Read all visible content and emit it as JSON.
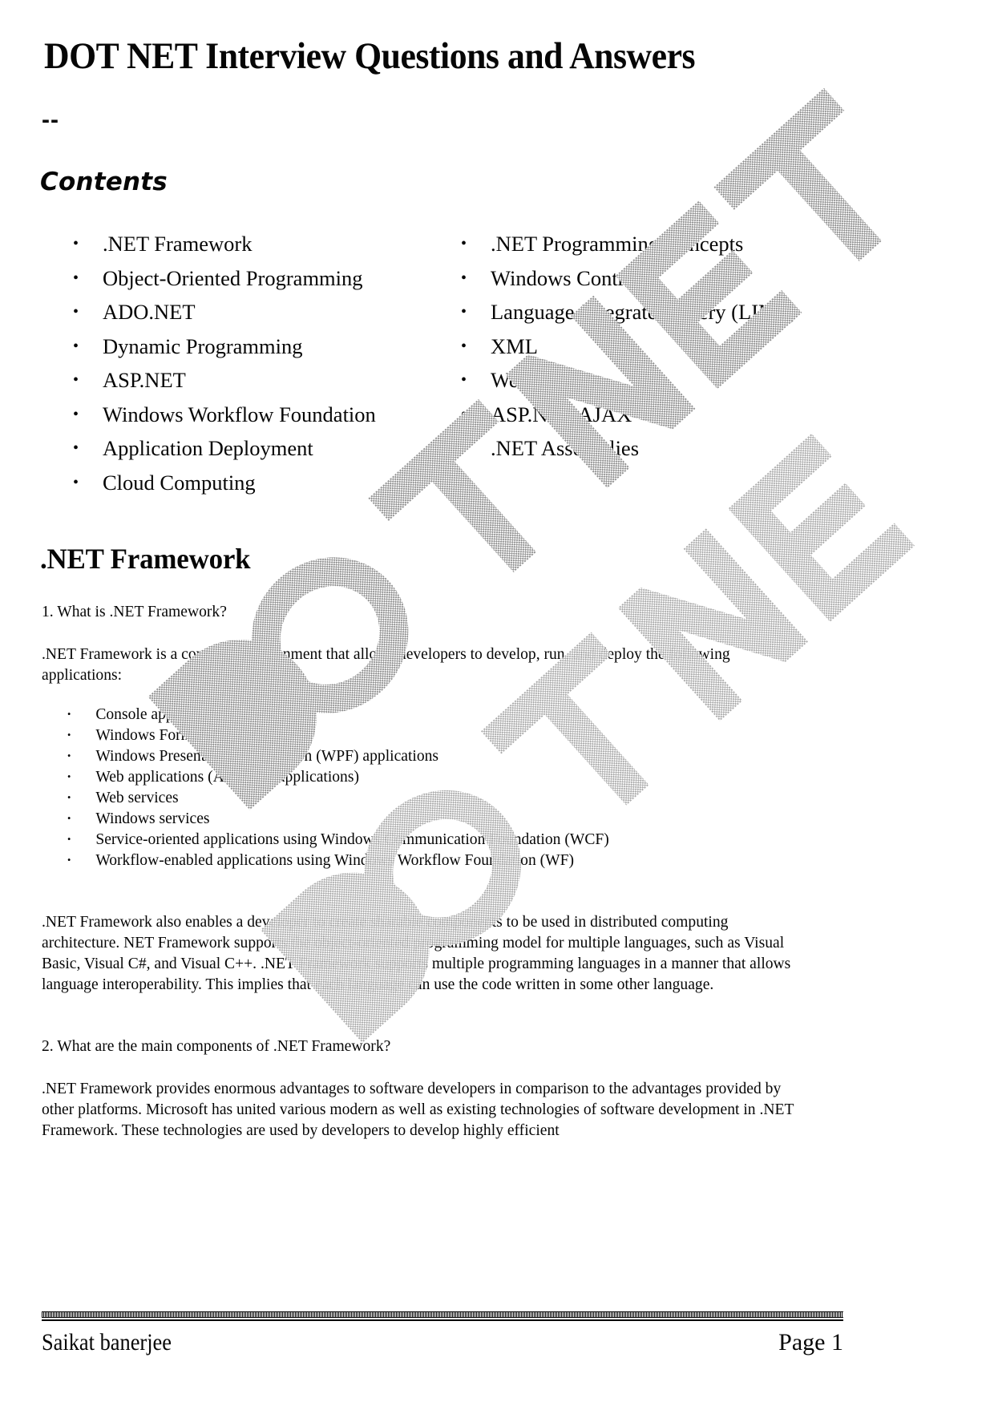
{
  "document": {
    "title": "DOT NET Interview Questions and Answers",
    "separator": "--",
    "contents_heading": "Contents"
  },
  "contents": {
    "left_column": [
      ".NET Framework",
      "Object-Oriented Programming",
      "ADO.NET",
      "Dynamic Programming",
      "ASP.NET",
      "Windows Workflow Foundation",
      "Application Deployment",
      "Cloud Computing"
    ],
    "right_column": [
      ".NET Programming Concepts",
      "Windows Controls",
      "Language-Integrated Query (LINQ)",
      "XML",
      "Web Services",
      "ASP.NET AJAX",
      ".NET Assemblies"
    ],
    "bullet_glyph": "•"
  },
  "section": {
    "heading": ".NET Framework",
    "question_1": "1. What is .NET Framework?",
    "answer_1_intro": ".NET Framework is a complete environment that allows developers to develop, run, and deploy the following applications:",
    "answer_1_list": [
      "Console applications",
      "Windows Forms applications",
      "Windows Presentation Foundation (WPF) applications",
      "Web applications (ASP.NET applications)",
      "Web services",
      "Windows services",
      "Service-oriented applications using Windows Communication Foundation (WCF)",
      "Workflow-enabled applications using Windows Workflow Foundation (WF)"
    ],
    "answer_1_body": ".NET Framework also enables a developer to create sharable components to be used in distributed computing architecture. NET Framework supports the object-oriented programming model for multiple languages, such as Visual Basic, Visual C#, and Visual C++. .NET Framework supports multiple programming languages in a manner that allows language interoperability. This implies that each language can use the code written in some other language.",
    "question_2": "2. What are the main components of .NET Framework?",
    "answer_2_body": ".NET Framework provides enormous advantages to software developers in comparison to the advantages provided by other platforms. Microsoft has united various modern as well as existing technologies of software development in .NET Framework. These technologies are used by developers to develop highly efficient",
    "sub_bullet_glyph": "•"
  },
  "footer": {
    "author": "Saikat banerjee",
    "page_label": "Page 1"
  },
  "watermark": {
    "text": "DOTNET",
    "color": "#b9b9b9"
  },
  "colors": {
    "page_background": "#ffffff",
    "text": "#060606",
    "rule": "#000000"
  }
}
